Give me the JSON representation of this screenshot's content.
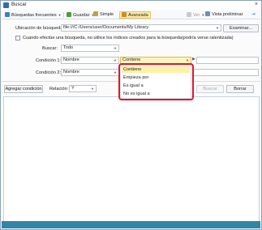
{
  "window": {
    "title": "Buscar",
    "close_glyph": "×"
  },
  "toolbar": {
    "frequent_label": "Búsquedas frecuentes",
    "save_label": "Guardar",
    "simple_label": "Simple",
    "advanced_label": "Avanzada",
    "view_label": "Ver",
    "preview_label": "Vista preliminar",
    "pin_glyph": "⇥"
  },
  "location": {
    "label": "Ubicación de búsqueda:",
    "value": "file:///C:/Users/user/Documents/My Library",
    "browse_label": "Examinar..."
  },
  "index_option": {
    "label": "Cuando efectúe una búsqueda, no utilice los índices creados para la búsqueda(podría verse ralentizada)",
    "checked": false
  },
  "search_in": {
    "label": "Buscar:",
    "value": "Todo"
  },
  "condition1": {
    "label": "Condición 1:",
    "field": "Nombre",
    "operator": "Contiene",
    "value": ""
  },
  "condition2": {
    "label": "Condición 2:",
    "field": "Nombre",
    "operator": "",
    "value": ""
  },
  "actions": {
    "add_condition_label": "Agregar condición",
    "relation_label": "Relación:",
    "relation_value": "Y",
    "search_label": "Buscar",
    "clear_label": "Borrar"
  },
  "operator_options": [
    "Contiene",
    "Empieza por",
    "Es igual a",
    "No es igual a"
  ],
  "operator_selected_index": 0,
  "colors": {
    "accent": "#2f86a6",
    "highlight": "#e0182d",
    "selection": "#fff0a8"
  },
  "icons": {
    "app": "search-window-icon",
    "frequent": "star-folder-icon",
    "save": "save-icon",
    "simple": "simple-search-icon",
    "advanced": "advanced-search-icon",
    "preview": "preview-pane-icon"
  }
}
